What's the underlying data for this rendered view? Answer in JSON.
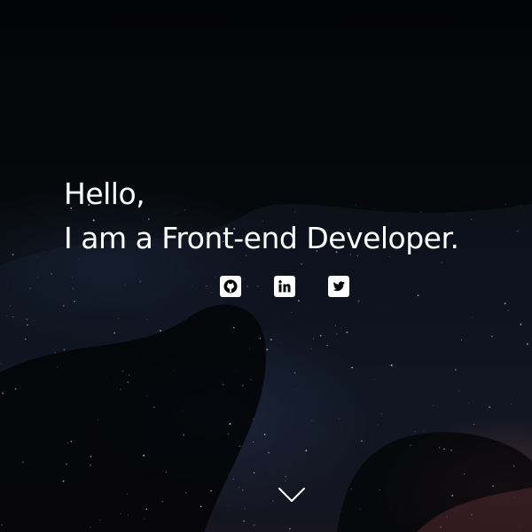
{
  "hero": {
    "greeting_line1": "Hello,",
    "greeting_line2": "I am a Front-end Developer."
  },
  "social_links": [
    {
      "name": "GitHub",
      "icon": "github-icon"
    },
    {
      "name": "LinkedIn",
      "icon": "linkedin-icon"
    },
    {
      "name": "Twitter",
      "icon": "twitter-icon"
    }
  ],
  "scroll_indicator": {
    "icon": "chevron-down-icon"
  },
  "colors": {
    "text": "#ffffff",
    "background": "#050608",
    "accent_nebula": "#964646"
  }
}
